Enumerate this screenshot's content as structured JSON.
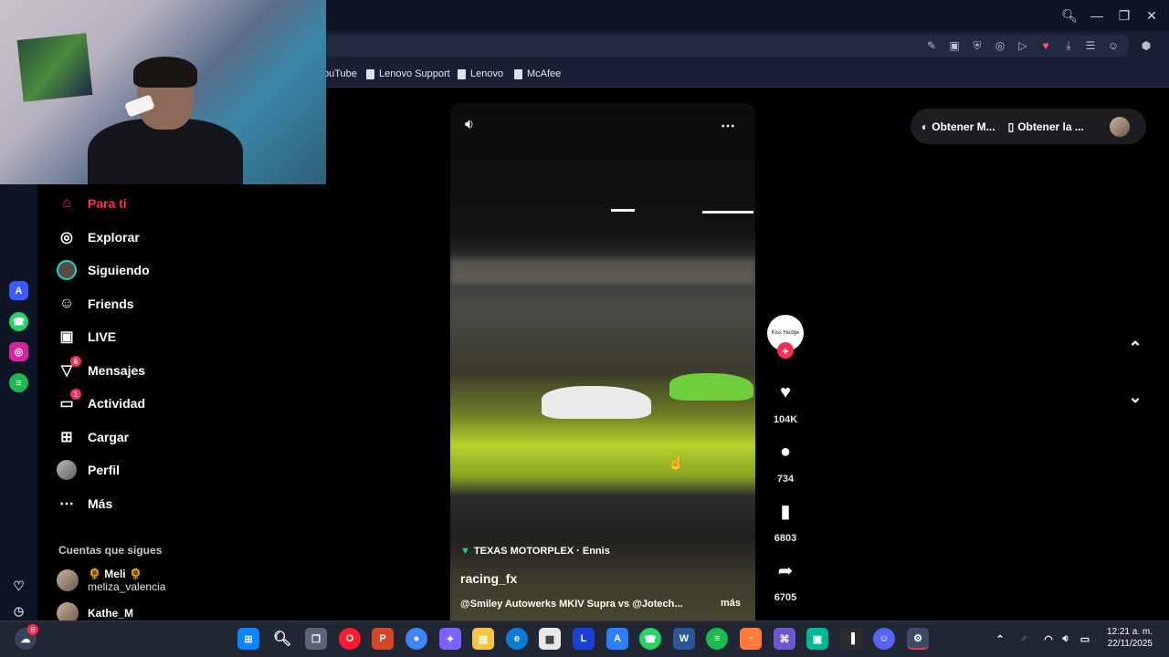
{
  "bookmarks": [
    {
      "label": "ouTube"
    },
    {
      "label": "Lenovo Support"
    },
    {
      "label": "Lenovo"
    },
    {
      "label": "McAfee"
    }
  ],
  "sidebar": {
    "items": [
      {
        "label": "Para ti",
        "icon": "home-icon"
      },
      {
        "label": "Explorar",
        "icon": "compass-icon"
      },
      {
        "label": "Siguiendo",
        "icon": "following-avatar-icon"
      },
      {
        "label": "Friends",
        "icon": "friends-icon"
      },
      {
        "label": "LIVE",
        "icon": "live-tv-icon"
      },
      {
        "label": "Mensajes",
        "icon": "messages-icon",
        "badge": "6"
      },
      {
        "label": "Actividad",
        "icon": "activity-icon",
        "badge": "1"
      },
      {
        "label": "Cargar",
        "icon": "upload-icon"
      },
      {
        "label": "Perfil",
        "icon": "profile-icon"
      },
      {
        "label": "Más",
        "icon": "more-icon"
      }
    ],
    "following_title": "Cuentas que sigues",
    "following": [
      {
        "name": "🌻 Meli 🌻",
        "handle": "meliza_valencia"
      },
      {
        "name": "Kathe_M",
        "handle": ""
      }
    ]
  },
  "top_actions": {
    "get_app_label": "Obtener M...",
    "get_desktop_label": "Obtener la ..."
  },
  "video": {
    "location": "TEXAS MOTORPLEX · Ennis",
    "author": "racing_fx",
    "caption": "@Smiley Autowerks MKIV Supra vs @Jotech...",
    "more_label": "más"
  },
  "actions": {
    "creator_avatar_text": "Kiss Hedge",
    "likes": "104K",
    "comments": "734",
    "saves": "6803",
    "shares": "6705"
  },
  "taskbar": {
    "notification_badge": "8",
    "time": "12:21 a. m.",
    "date": "22/11/2025"
  },
  "colors": {
    "accent": "#fe2c55",
    "titlebar": "#0f1524",
    "taskbar": "#202633"
  }
}
